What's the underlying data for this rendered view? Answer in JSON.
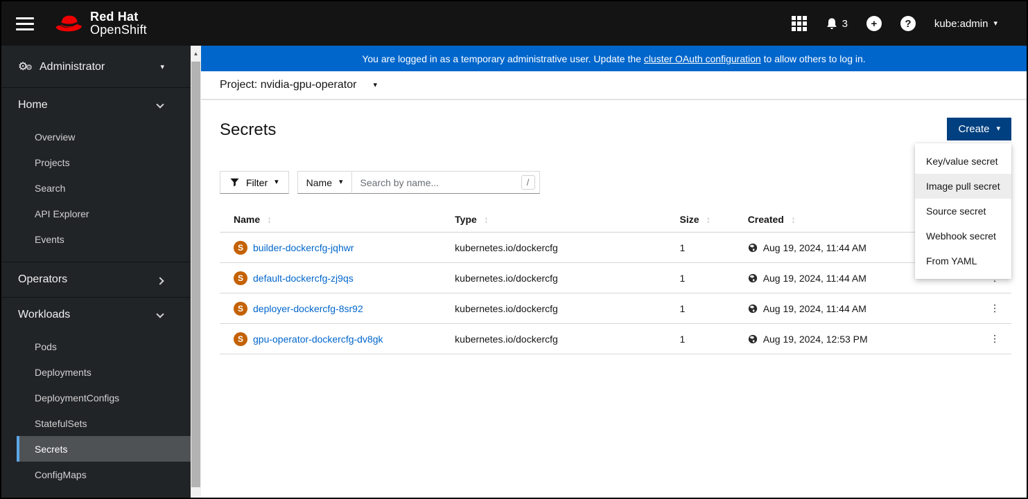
{
  "masthead": {
    "brand_line1": "Red Hat",
    "brand_line2": "OpenShift",
    "notification_count": "3",
    "username": "kube:admin"
  },
  "banner": {
    "text_before": "You are logged in as a temporary administrative user. Update the ",
    "link_text": "cluster OAuth configuration",
    "text_after": " to allow others to log in."
  },
  "project_bar": {
    "label": "Project:",
    "value": "nvidia-gpu-operator"
  },
  "page": {
    "title": "Secrets"
  },
  "toolbar": {
    "create_label": "Create",
    "filter_label": "Filter",
    "name_filter_label": "Name",
    "search_placeholder": "Search by name...",
    "search_shortcut": "/"
  },
  "create_menu": {
    "items": [
      {
        "label": "Key/value secret",
        "active": false
      },
      {
        "label": "Image pull secret",
        "active": true
      },
      {
        "label": "Source secret",
        "active": false
      },
      {
        "label": "Webhook secret",
        "active": false
      },
      {
        "label": "From YAML",
        "active": false
      }
    ]
  },
  "table": {
    "columns": [
      "Name",
      "Type",
      "Size",
      "Created"
    ],
    "rows": [
      {
        "badge": "S",
        "name": "builder-dockercfg-jqhwr",
        "type": "kubernetes.io/dockercfg",
        "size": "1",
        "created": "Aug 19, 2024, 11:44 AM"
      },
      {
        "badge": "S",
        "name": "default-dockercfg-zj9qs",
        "type": "kubernetes.io/dockercfg",
        "size": "1",
        "created": "Aug 19, 2024, 11:44 AM"
      },
      {
        "badge": "S",
        "name": "deployer-dockercfg-8sr92",
        "type": "kubernetes.io/dockercfg",
        "size": "1",
        "created": "Aug 19, 2024, 11:44 AM"
      },
      {
        "badge": "S",
        "name": "gpu-operator-dockercfg-dv8gk",
        "type": "kubernetes.io/dockercfg",
        "size": "1",
        "created": "Aug 19, 2024, 12:53 PM"
      }
    ]
  },
  "sidebar": {
    "perspective": "Administrator",
    "sections": [
      {
        "label": "Home",
        "expanded": true,
        "items": [
          "Overview",
          "Projects",
          "Search",
          "API Explorer",
          "Events"
        ],
        "active_item": ""
      },
      {
        "label": "Operators",
        "expanded": false,
        "items": [],
        "active_item": ""
      },
      {
        "label": "Workloads",
        "expanded": true,
        "items": [
          "Pods",
          "Deployments",
          "DeploymentConfigs",
          "StatefulSets",
          "Secrets",
          "ConfigMaps"
        ],
        "active_item": "Secrets"
      }
    ]
  },
  "icons": {
    "caret_down": "▾",
    "kebab": "⋮",
    "sort": "↕",
    "gear": "⚙",
    "scroll_up_arrow": "▲"
  },
  "colors": {
    "banner_blue": "#0066cc",
    "primary_active_blue": "#004080",
    "link_blue": "#0066cc",
    "secret_badge_orange": "#c46100",
    "nav_active_bg": "#4f5255",
    "nav_active_border": "#5ba7e8"
  }
}
